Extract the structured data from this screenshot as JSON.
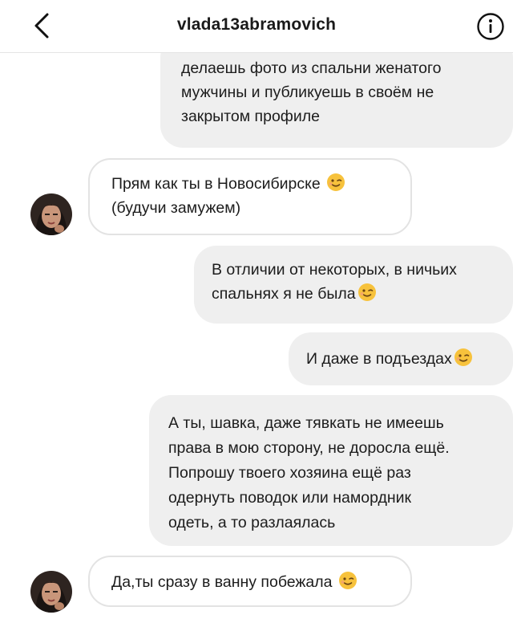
{
  "header": {
    "username": "vlada13abramovich",
    "back_icon": "chevron-left-icon",
    "info_icon": "info-circle-icon"
  },
  "colors": {
    "sent_bubble": "#efefef",
    "received_border": "#e3e3e3",
    "emoji_face": "#f7c23c"
  },
  "messages": [
    {
      "direction": "sent",
      "lines": [
        "делаешь фото из спальни женатого",
        "мужчины и публикуешь в своём не",
        "закрытом профиле"
      ]
    },
    {
      "direction": "received",
      "lines": [
        "Прям как ты в Новосибирске",
        "(будучи замужем)"
      ],
      "emoji": "winking-face"
    },
    {
      "direction": "sent",
      "lines": [
        "В отличии от некоторых, в ничьих",
        "спальнях я не была"
      ],
      "emoji": "winking-face"
    },
    {
      "direction": "sent",
      "lines": [
        "И даже в подъездах"
      ],
      "emoji": "winking-face"
    },
    {
      "direction": "sent",
      "lines": [
        "А ты, шавка, даже тявкать не имеешь",
        "права в мою сторону, не доросла ещё.",
        "Попрошу твоего хозяина ещё раз",
        "одернуть поводок или намордник",
        "одеть, а то разлаялась"
      ]
    },
    {
      "direction": "received",
      "lines": [
        "Да,ты сразу в ванну побежала"
      ],
      "emoji": "winking-face"
    }
  ]
}
